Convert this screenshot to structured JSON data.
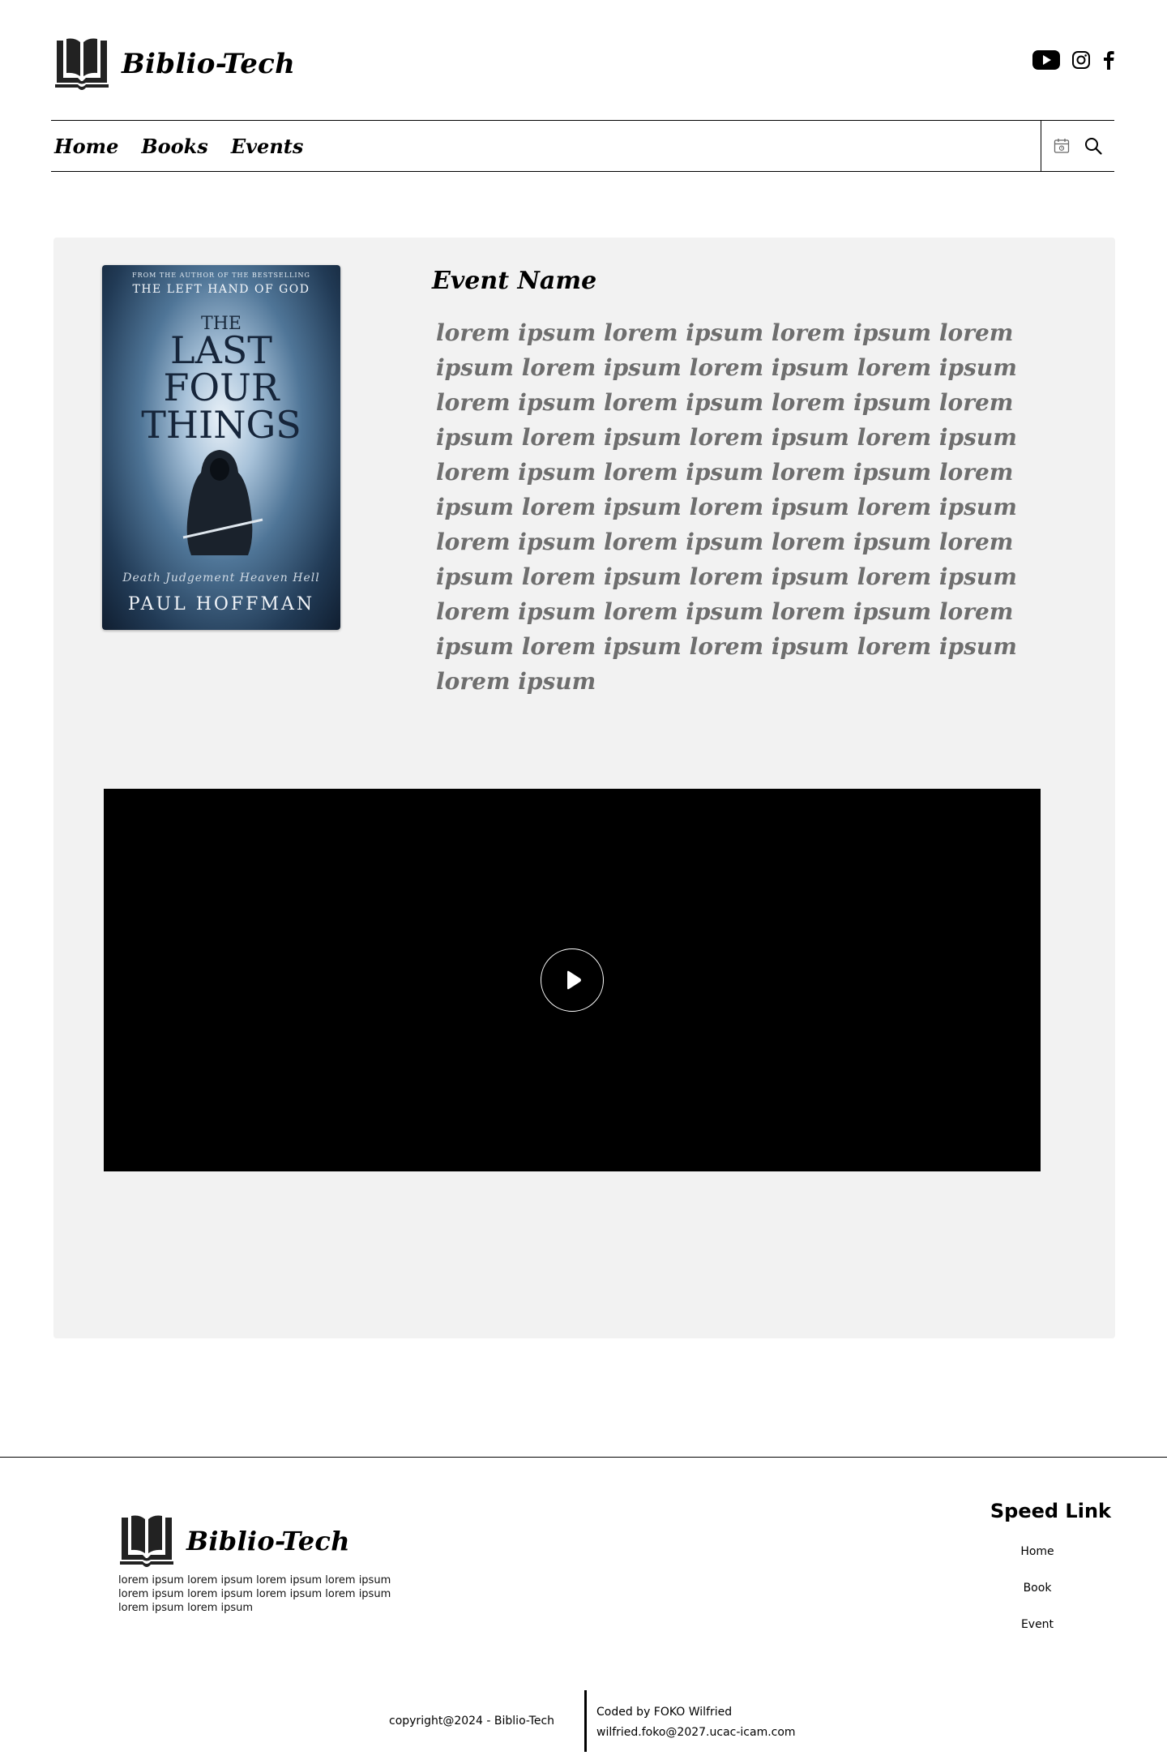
{
  "header": {
    "brand": "Biblio-Tech",
    "socials": [
      {
        "icon": "youtube-icon"
      },
      {
        "icon": "instagram-icon"
      },
      {
        "icon": "facebook-icon"
      }
    ]
  },
  "nav": {
    "links": [
      "Home",
      "Books",
      "Events"
    ],
    "tools": [
      {
        "icon": "calendar-icon"
      },
      {
        "icon": "search-icon"
      }
    ]
  },
  "event": {
    "name": "Event Name",
    "description": "lorem ipsum lorem ipsum lorem ipsum lorem ipsum lorem ipsum lorem ipsum lorem ipsum lorem ipsum lorem ipsum lorem ipsum lorem ipsum lorem ipsum lorem ipsum lorem ipsum lorem ipsum lorem ipsum lorem ipsum lorem ipsum lorem ipsum lorem ipsum lorem ipsum lorem ipsum lorem ipsum lorem ipsum lorem ipsum lorem ipsum lorem ipsum lorem ipsum lorem ipsum lorem ipsum lorem ipsum lorem ipsum lorem ipsum lorem ipsum lorem ipsum lorem ipsum",
    "cover": {
      "top_line": "FROM THE AUTHOR OF THE BESTSELLING",
      "subtitle": "THE LEFT HAND OF GOD",
      "the": "THE",
      "title_line1": "LAST",
      "title_line2": "FOUR",
      "title_line3": "THINGS",
      "words": "Death  Judgement  Heaven  Hell",
      "author": "PAUL HOFFMAN"
    },
    "video": {
      "icon": "play-icon"
    }
  },
  "footer": {
    "brand": "Biblio-Tech",
    "description": "lorem ipsum lorem ipsum lorem ipsum lorem ipsum lorem ipsum lorem ipsum lorem ipsum lorem ipsum lorem ipsum lorem ipsum",
    "speed_link_title": "Speed Link",
    "speed_links": [
      "Home",
      "Book",
      "Event"
    ],
    "copyright": "copyright@2024 - Biblio-Tech",
    "coded_by": "Coded by FOKO Wilfried",
    "email": "wilfried.foko@2027.ucac-icam.com"
  }
}
